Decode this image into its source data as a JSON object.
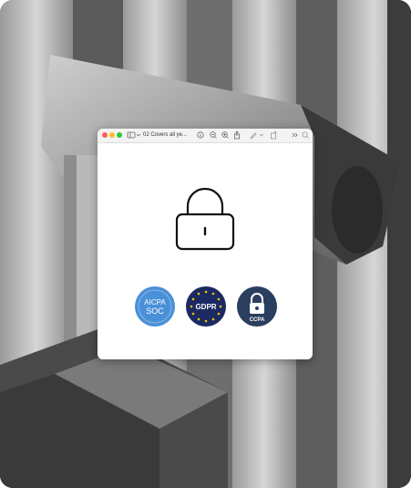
{
  "window": {
    "title": "02 Covers all ye...",
    "traffic_lights": [
      "close",
      "minimize",
      "zoom"
    ],
    "toolbar_icons": [
      "sidebar-icon",
      "chevron-down-icon",
      "info-icon",
      "zoom-out-icon",
      "zoom-in-icon",
      "share-icon",
      "markup-icon",
      "chevron-down-icon",
      "rotate-icon",
      "more-icon",
      "search-icon"
    ]
  },
  "content": {
    "lock_icon": "padlock-icon",
    "badges": [
      {
        "name": "aicpa-soc",
        "line1": "AICPA",
        "line2": "SOC",
        "color": "#4a90d9"
      },
      {
        "name": "gdpr",
        "label": "GDPR",
        "color": "#1c2a63"
      },
      {
        "name": "ccpa",
        "label": "CCPA",
        "color": "#2a3e5f"
      }
    ]
  },
  "colors": {
    "accent_blue": "#4a90d9",
    "gdpr_navy": "#1c2a63",
    "ccpa_slate": "#2a3e5f",
    "gdpr_star": "#f2c500"
  }
}
